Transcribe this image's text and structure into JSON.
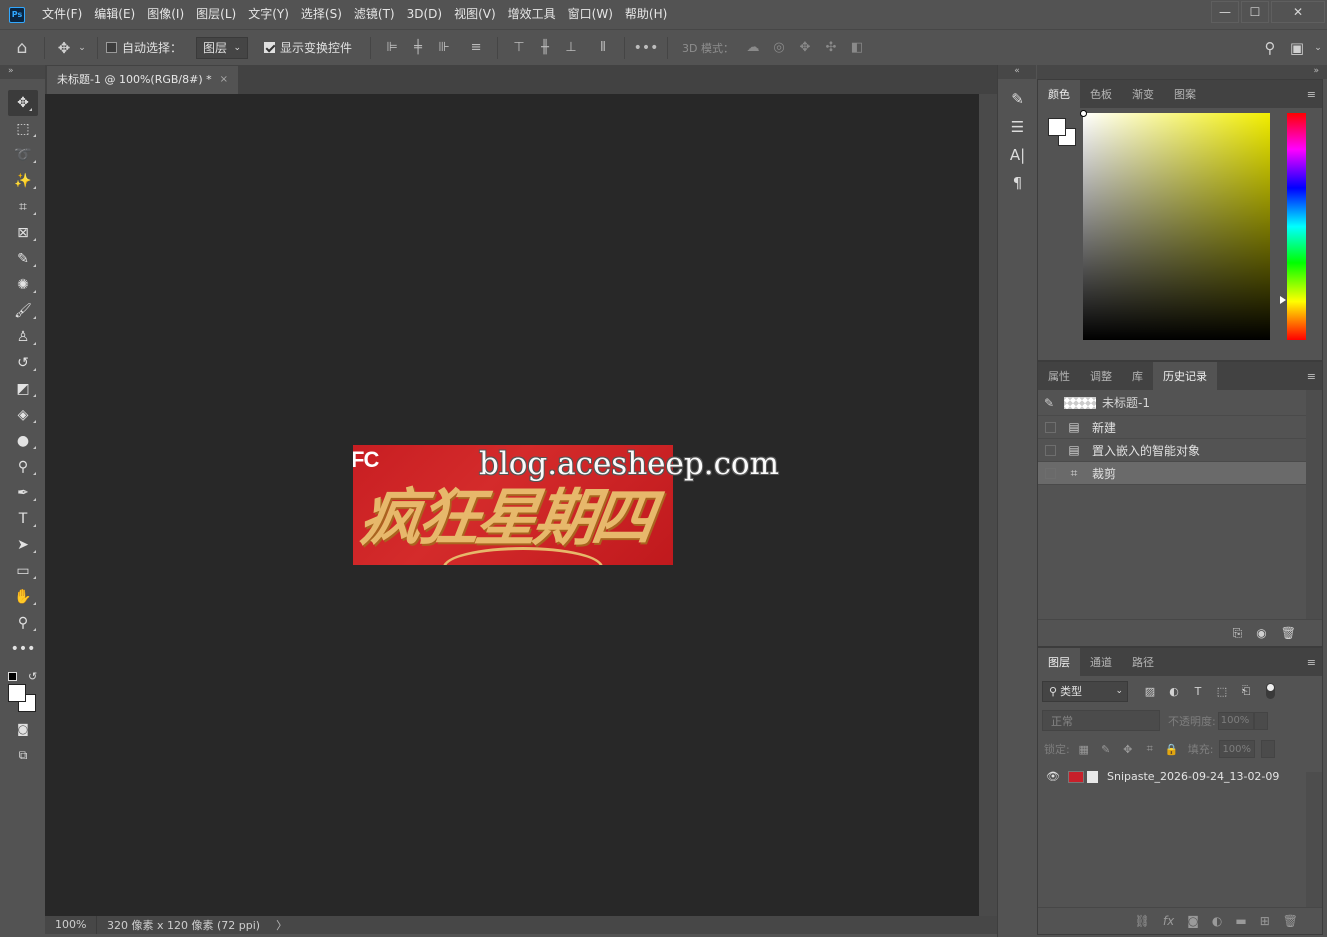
{
  "app": {
    "logo": "Ps"
  },
  "menu": [
    "文件(F)",
    "编辑(E)",
    "图像(I)",
    "图层(L)",
    "文字(Y)",
    "选择(S)",
    "滤镜(T)",
    "3D(D)",
    "视图(V)",
    "增效工具",
    "窗口(W)",
    "帮助(H)"
  ],
  "window_controls": {
    "minimize": "—",
    "maximize": "☐",
    "close": "✕"
  },
  "options": {
    "auto_select_label": "自动选择：",
    "auto_select_checked": false,
    "auto_select_target": "图层",
    "show_transform_label": "显示变换控件",
    "show_transform_checked": true,
    "mode_3d_label": "3D 模式："
  },
  "document": {
    "tab_title": "未标题-1 @ 100%(RGB/8#) *",
    "close_label": "×",
    "image": {
      "brand_text": "FC",
      "title_text": "疯狂星期四"
    },
    "watermark": "blog.acesheep.com"
  },
  "status": {
    "zoom": "100%",
    "info": "320 像素 x 120 像素 (72 ppi)",
    "arrow": "〉"
  },
  "collapse_arrows": {
    "left": "»",
    "middle": "«",
    "right": "»"
  },
  "tools": [
    {
      "name": "move-tool",
      "glyph": "✥",
      "active": true
    },
    {
      "name": "marquee-tool",
      "glyph": "⬚"
    },
    {
      "name": "lasso-tool",
      "glyph": "➰"
    },
    {
      "name": "magic-wand-tool",
      "glyph": "✨"
    },
    {
      "name": "crop-tool",
      "glyph": "⌗"
    },
    {
      "name": "frame-tool",
      "glyph": "⊠"
    },
    {
      "name": "eyedropper-tool",
      "glyph": "✎"
    },
    {
      "name": "healing-brush-tool",
      "glyph": "✺"
    },
    {
      "name": "brush-tool",
      "glyph": "🖌"
    },
    {
      "name": "stamp-tool",
      "glyph": "♙"
    },
    {
      "name": "history-brush-tool",
      "glyph": "↺"
    },
    {
      "name": "eraser-tool",
      "glyph": "◩"
    },
    {
      "name": "paint-bucket-tool",
      "glyph": "◈"
    },
    {
      "name": "blur-tool",
      "glyph": "●"
    },
    {
      "name": "dodge-tool",
      "glyph": "⚲"
    },
    {
      "name": "pen-tool",
      "glyph": "✒"
    },
    {
      "name": "type-tool",
      "glyph": "T"
    },
    {
      "name": "path-selection-tool",
      "glyph": "➤"
    },
    {
      "name": "rectangle-tool",
      "glyph": "▭"
    },
    {
      "name": "hand-tool",
      "glyph": "✋"
    },
    {
      "name": "zoom-tool",
      "glyph": "⚲"
    },
    {
      "name": "more-tools",
      "glyph": "•••"
    }
  ],
  "dock_icons": [
    "brush-settings-icon",
    "adjustments-sliders-icon",
    "character-icon",
    "paragraph-icon"
  ],
  "dock_glyphs": [
    "✎",
    "☰",
    "A|",
    "¶"
  ],
  "color_panel": {
    "tabs": [
      "颜色",
      "色板",
      "渐变",
      "图案"
    ],
    "active_tab": 0,
    "foreground": "#ffffff",
    "background": "#ffffff"
  },
  "history_panel": {
    "tabs": [
      "属性",
      "调整",
      "库",
      "历史记录"
    ],
    "active_tab": 3,
    "snapshot": "未标题-1",
    "items": [
      {
        "label": "新建",
        "icon": "▤"
      },
      {
        "label": "置入嵌入的智能对象",
        "icon": "▤"
      },
      {
        "label": "裁剪",
        "icon": "⌗",
        "selected": true
      }
    ]
  },
  "layers_panel": {
    "tabs": [
      "图层",
      "通道",
      "路径"
    ],
    "active_tab": 0,
    "kind_label": "类型",
    "blend_mode": "正常",
    "opacity_label": "不透明度:",
    "opacity_value": "100%",
    "lock_label": "锁定:",
    "fill_label": "填充:",
    "fill_value": "100%",
    "layers": [
      {
        "name": "Snipaste_2026-09-24_13-02-09",
        "visible": true
      }
    ]
  },
  "colors": {
    "accent": "#31a8ff",
    "image_red": "#c81e22",
    "image_gold": "#e7b86b"
  }
}
